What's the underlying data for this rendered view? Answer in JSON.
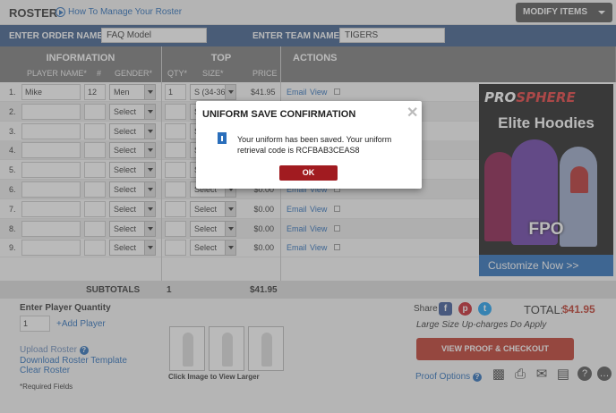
{
  "header": {
    "title": "ROSTER",
    "help_link": "How To Manage Your Roster",
    "modify_button": "MODIFY ITEMS"
  },
  "order": {
    "order_label": "ENTER ORDER NAME:*",
    "order_value": "FAQ Model",
    "team_label": "ENTER TEAM NAME:*",
    "team_value": "TIGERS"
  },
  "sections": {
    "information": {
      "title": "INFORMATION",
      "col_player": "PLAYER NAME*",
      "col_num": "#",
      "col_gender": "GENDER*"
    },
    "top": {
      "title": "TOP",
      "col_qty": "QTY*",
      "col_size": "SIZE*",
      "col_price": "PRICE"
    },
    "actions": {
      "title": "ACTIONS"
    }
  },
  "rows": [
    {
      "n": "1.",
      "name": "Mike",
      "num": "12",
      "gender": "Men",
      "qty": "1",
      "size": "S (34-36)",
      "price": "$41.95",
      "email": "Email",
      "view": "View"
    },
    {
      "n": "2.",
      "name": "",
      "num": "",
      "gender": "Select",
      "qty": "",
      "size": "S",
      "price": "",
      "email": "",
      "view": ""
    },
    {
      "n": "3.",
      "name": "",
      "num": "",
      "gender": "Select",
      "qty": "",
      "size": "S",
      "price": "",
      "email": "",
      "view": ""
    },
    {
      "n": "4.",
      "name": "",
      "num": "",
      "gender": "Select",
      "qty": "",
      "size": "S",
      "price": "",
      "email": "",
      "view": ""
    },
    {
      "n": "5.",
      "name": "",
      "num": "",
      "gender": "Select",
      "qty": "",
      "size": "S",
      "price": "",
      "email": "",
      "view": ""
    },
    {
      "n": "6.",
      "name": "",
      "num": "",
      "gender": "Select",
      "qty": "",
      "size": "Select",
      "price": "$0.00",
      "email": "Email",
      "view": "View"
    },
    {
      "n": "7.",
      "name": "",
      "num": "",
      "gender": "Select",
      "qty": "",
      "size": "Select",
      "price": "$0.00",
      "email": "Email",
      "view": "View"
    },
    {
      "n": "8.",
      "name": "",
      "num": "",
      "gender": "Select",
      "qty": "",
      "size": "Select",
      "price": "$0.00",
      "email": "Email",
      "view": "View"
    },
    {
      "n": "9.",
      "name": "",
      "num": "",
      "gender": "Select",
      "qty": "",
      "size": "Select",
      "price": "$0.00",
      "email": "Email",
      "view": "View"
    }
  ],
  "ad": {
    "brand_a": "PRO",
    "brand_b": "SPHERE",
    "title": "Elite Hoodies",
    "fpo": "FPO",
    "cta": "Customize Now >>"
  },
  "subtotals": {
    "label": "SUBTOTALS",
    "qty": "1",
    "price": "$41.95"
  },
  "bottom": {
    "qty_label": "Enter Player Quantity",
    "qty_value": "1",
    "add_player": "+Add Player",
    "upload": "Upload Roster",
    "download": "Download Roster Template",
    "clear": "Clear Roster",
    "required": "*Required Fields",
    "thumbs_caption": "Click Image to View Larger",
    "share": "Share",
    "total_label": "TOTAL:",
    "total_value": "$41.95",
    "upcharge": "Large Size Up-charges Do Apply",
    "proof_button": "VIEW PROOF & CHECKOUT",
    "proof_options": "Proof Options"
  },
  "modal": {
    "title": "UNIFORM SAVE CONFIRMATION",
    "message": "Your uniform has been saved. Your uniform retrieval code is RCFBAB3CEAS8",
    "ok": "OK"
  },
  "colors": {
    "header_bar": "#3d5e8c",
    "accent_red": "#c0392b",
    "link": "#2a6ebb"
  }
}
